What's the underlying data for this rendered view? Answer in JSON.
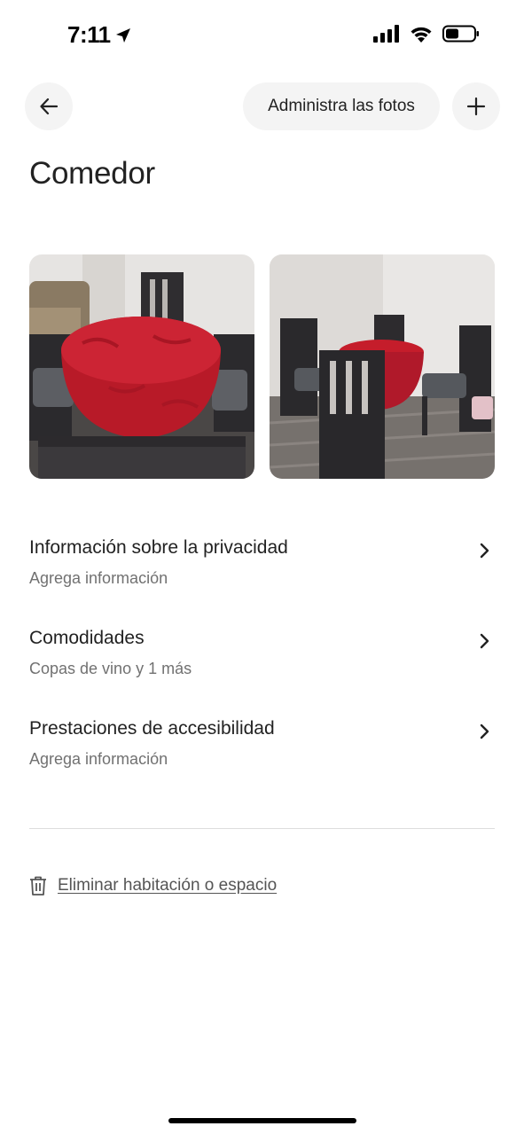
{
  "status_bar": {
    "time": "7:11",
    "icons": [
      "location-arrow-icon",
      "signal-icon",
      "wifi-icon",
      "battery-icon"
    ]
  },
  "nav": {
    "back_icon": "arrow-left-icon",
    "manage_photos_label": "Administra las fotos",
    "add_icon": "plus-icon"
  },
  "title": "Comedor",
  "photos": [
    {
      "subject": "dining-table-red-tablecloth-close"
    },
    {
      "subject": "dining-table-red-tablecloth-wide"
    }
  ],
  "sections": [
    {
      "title": "Información sobre la privacidad",
      "subtitle": "Agrega información"
    },
    {
      "title": "Comodidades",
      "subtitle": "Copas de vino y 1 más"
    },
    {
      "title": "Prestaciones de accesibilidad",
      "subtitle": "Agrega información"
    }
  ],
  "delete_action": {
    "icon": "trash-icon",
    "label": "Eliminar habitación o espacio"
  },
  "colors": {
    "text_primary": "#222222",
    "text_secondary": "#717171",
    "button_bg": "#f4f4f4",
    "divider": "#dddddd"
  }
}
